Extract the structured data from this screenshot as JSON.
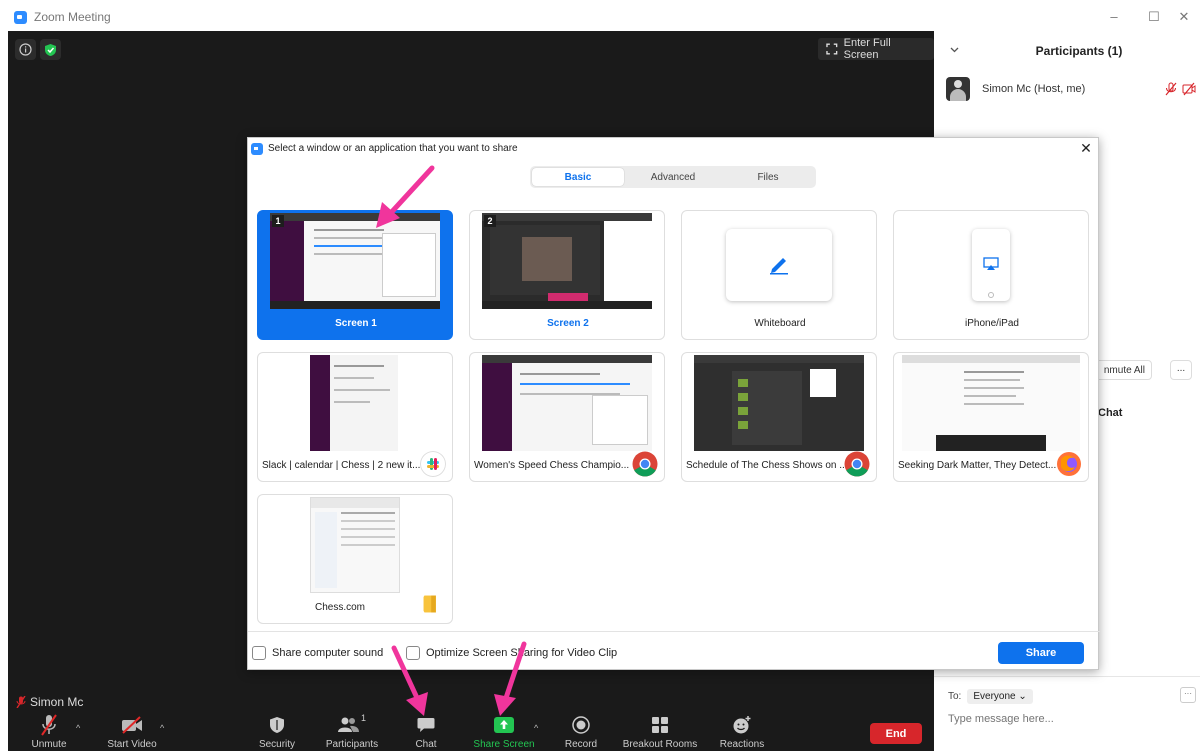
{
  "window": {
    "title": "Zoom Meeting",
    "controls": [
      "–",
      "☐",
      "✕"
    ]
  },
  "video": {
    "fullscreen_label": "Enter Full Screen",
    "name_tag": "Simon Mc"
  },
  "toolbar": {
    "items": [
      {
        "label": "Unmute",
        "icon": "mic-muted-icon"
      },
      {
        "label": "Start Video",
        "icon": "video-off-icon"
      },
      {
        "label": "Security",
        "icon": "shield-icon"
      },
      {
        "label": "Participants",
        "icon": "participants-icon",
        "count": "1"
      },
      {
        "label": "Chat",
        "icon": "chat-icon"
      },
      {
        "label": "Share Screen",
        "icon": "share-screen-icon"
      },
      {
        "label": "Record",
        "icon": "record-icon"
      },
      {
        "label": "Breakout Rooms",
        "icon": "breakout-rooms-icon"
      },
      {
        "label": "Reactions",
        "icon": "reactions-icon"
      }
    ],
    "end_label": "End"
  },
  "panel": {
    "title": "Participants (1)",
    "participant_name": "Simon Mc (Host, me)",
    "unmute_all": "nmute All",
    "more": "...",
    "chat_title": "Chat",
    "to_label": "To:",
    "to_value": "Everyone ⌄",
    "chat_placeholder": "Type message here..."
  },
  "dialog": {
    "title": "Select a window or an application that you want to share",
    "tabs": [
      "Basic",
      "Advanced",
      "Files"
    ],
    "tiles": [
      {
        "label": "Screen 1",
        "badge": "1",
        "selected": true
      },
      {
        "label": "Screen 2",
        "badge": "2"
      },
      {
        "label": "Whiteboard"
      },
      {
        "label": "iPhone/iPad"
      },
      {
        "label": "Slack | calendar | Chess | 2 new it...",
        "app": "slack-icon"
      },
      {
        "label": "Women's Speed Chess Champio...",
        "app": "chrome-icon"
      },
      {
        "label": "Schedule of The Chess Shows on ...",
        "app": "chrome-icon"
      },
      {
        "label": "Seeking Dark Matter, They Detect...",
        "app": "firefox-icon"
      },
      {
        "label": "Chess.com",
        "app": "folder-icon"
      }
    ],
    "share_sound": "Share computer sound",
    "optimize": "Optimize Screen Sharing for Video Clip",
    "share_button": "Share"
  },
  "colors": {
    "accent": "#0e72ed",
    "end": "#d7262b",
    "share_green": "#23c552",
    "annotation_arrow": "#f0359c"
  }
}
